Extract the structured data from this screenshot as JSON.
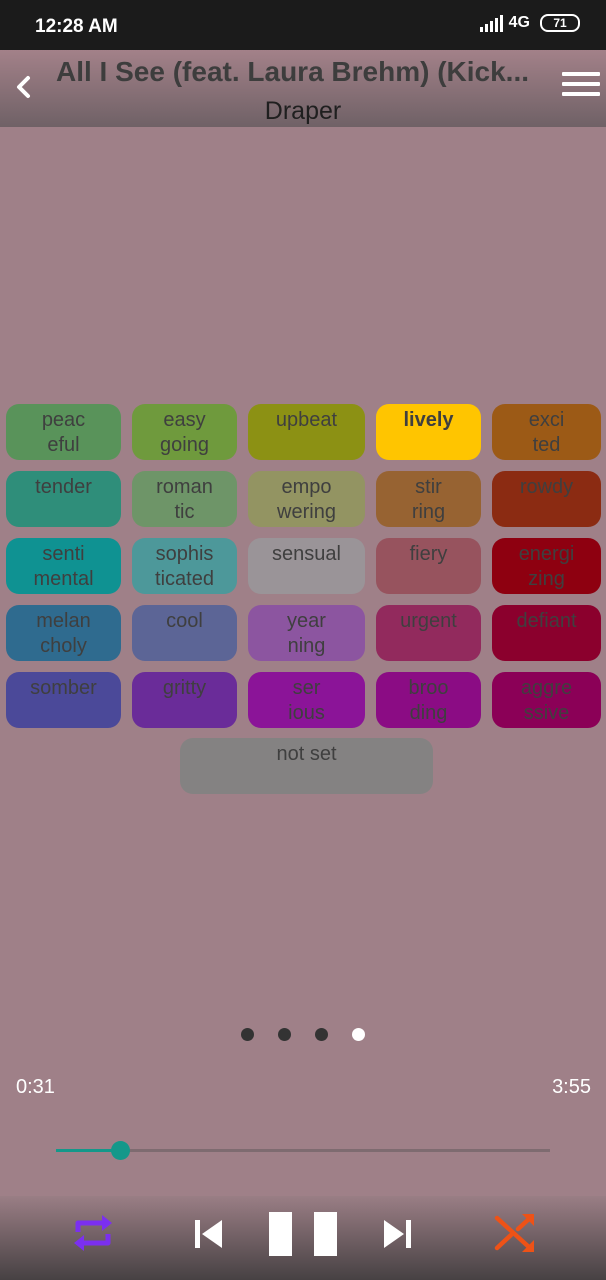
{
  "status_bar": {
    "time": "12:28 AM",
    "network": "4G",
    "battery": "71"
  },
  "header": {
    "title": "All I See (feat. Laura Brehm) (Kick...",
    "artist": "Draper"
  },
  "moods": [
    {
      "label": "peac\neful",
      "color": "#59935a"
    },
    {
      "label": "easy\ngoing",
      "color": "#6f9a3d"
    },
    {
      "label": "upbeat",
      "color": "#8c9114"
    },
    {
      "label": "lively",
      "color": "#ffc500",
      "selected": true
    },
    {
      "label": "exci\nted",
      "color": "#9c5a16"
    },
    {
      "label": "tender",
      "color": "#2f8e7a"
    },
    {
      "label": "roman\ntic",
      "color": "#6e9568"
    },
    {
      "label": "empo\nwering",
      "color": "#939462"
    },
    {
      "label": "stir\nring",
      "color": "#976332"
    },
    {
      "label": "rowdy",
      "color": "#8b2b12"
    },
    {
      "label": "senti\nmental",
      "color": "#0f9292"
    },
    {
      "label": "sophis\nticated",
      "color": "#4d989a"
    },
    {
      "label": "sensual",
      "color": "#9a9498"
    },
    {
      "label": "fiery",
      "color": "#97535e"
    },
    {
      "label": "energi\nzing",
      "color": "#8e0010"
    },
    {
      "label": "melan\ncholy",
      "color": "#2f6b8f"
    },
    {
      "label": "cool",
      "color": "#5c6596"
    },
    {
      "label": "year\nning",
      "color": "#8c55a0"
    },
    {
      "label": "urgent",
      "color": "#922a5d"
    },
    {
      "label": "defiant",
      "color": "#8b002d"
    },
    {
      "label": "somber",
      "color": "#4b4999"
    },
    {
      "label": "gritty",
      "color": "#6a2c99"
    },
    {
      "label": "ser\nious",
      "color": "#8b1498"
    },
    {
      "label": "broo\nding",
      "color": "#8b0c84"
    },
    {
      "label": "aggre\nssive",
      "color": "#8b0057"
    }
  ],
  "not_set": {
    "label": "not set",
    "color": "#848282"
  },
  "pager": {
    "count": 4,
    "active": 4
  },
  "player": {
    "elapsed": "0:31",
    "duration": "3:55",
    "progress": 0.13,
    "accent_color": "#14988a",
    "repeat_icon": "repeat-icon",
    "repeat_color": "#7b2ff0",
    "shuffle_icon": "shuffle-icon",
    "shuffle_color": "#ee5217"
  }
}
